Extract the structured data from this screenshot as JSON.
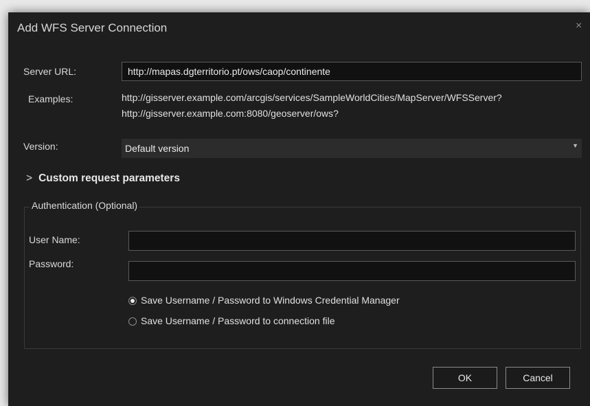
{
  "dialog": {
    "title": "Add WFS Server Connection",
    "close": "×"
  },
  "server_url": {
    "label": "Server URL:",
    "value": "http://mapas.dgterritorio.pt/ows/caop/continente"
  },
  "examples": {
    "label": "Examples:",
    "lines": [
      "http://gisserver.example.com/arcgis/services/SampleWorldCities/MapServer/WFSServer?",
      "http://gisserver.example.com:8080/geoserver/ows?"
    ]
  },
  "version": {
    "label": "Version:",
    "selected": "Default version",
    "caret": "▼"
  },
  "custom_params": {
    "chevron": ">",
    "label": "Custom request parameters"
  },
  "auth": {
    "legend": "Authentication (Optional)",
    "username_label": "User Name:",
    "username_value": "",
    "password_label": "Password:",
    "password_value": "",
    "options": [
      {
        "label": "Save Username / Password to Windows Credential Manager",
        "selected": true
      },
      {
        "label": "Save Username / Password to connection file",
        "selected": false
      }
    ]
  },
  "buttons": {
    "ok": "OK",
    "cancel": "Cancel"
  }
}
